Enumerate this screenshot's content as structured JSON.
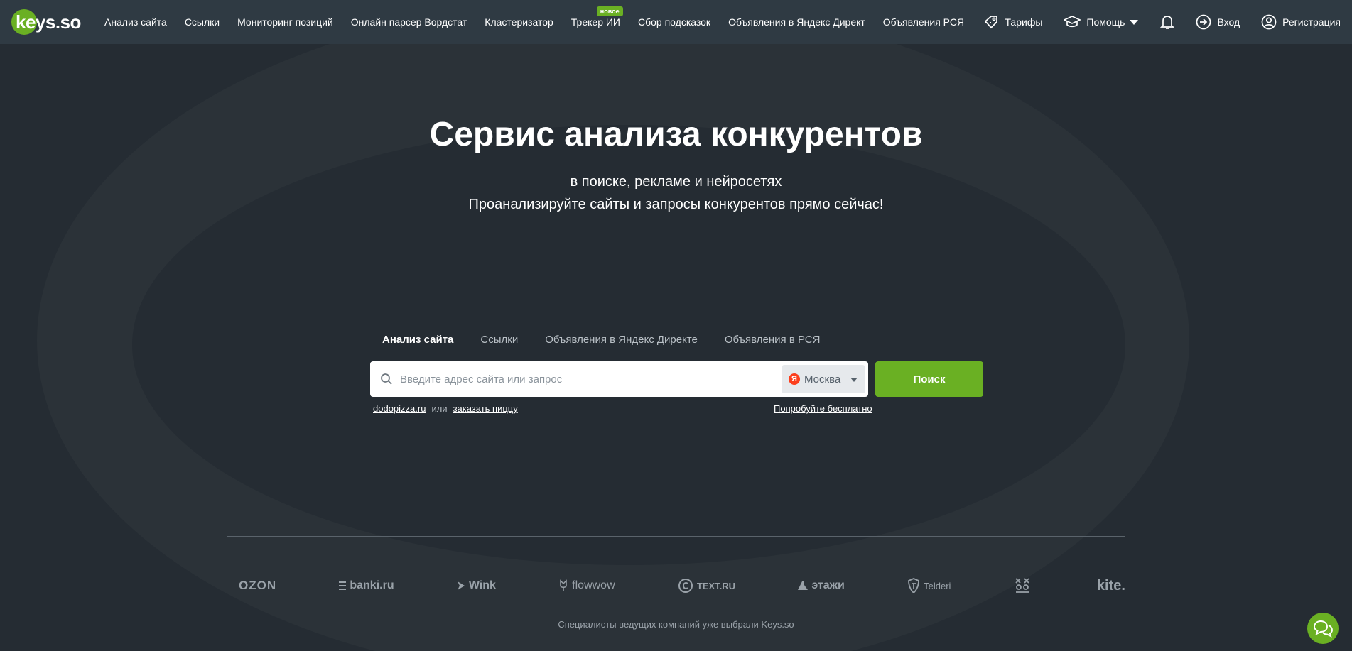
{
  "brand": {
    "name": "keys.so",
    "accent": "#6ab023"
  },
  "nav": {
    "items": [
      "Анализ сайта",
      "Ссылки",
      "Мониторинг позиций",
      "Онлайн парсер Вордстат",
      "Кластеризатор",
      "Трекер ИИ",
      "Сбор подсказок",
      "Объявления в Яндекс Директ",
      "Объявления РСЯ"
    ],
    "badge": "новое",
    "more": "···"
  },
  "right_nav": {
    "pricing": "Тарифы",
    "help": "Помощь",
    "login": "Вход",
    "register": "Регистрация"
  },
  "hero": {
    "title": "Сервис анализа конкурентов",
    "subtitle_1": "в поиске, рекламе и нейросетях",
    "subtitle_2": "Проанализируйте сайты и запросы конкурентов прямо сейчас!"
  },
  "search": {
    "tabs": [
      "Анализ сайта",
      "Ссылки",
      "Объявления в Яндекс Директе",
      "Объявления в РСЯ"
    ],
    "placeholder": "Введите адрес сайта или запрос",
    "region": "Москва",
    "region_badge": "Я",
    "button": "Поиск",
    "example_1": "dodopizza.ru",
    "example_or": "или",
    "example_2": "заказать пиццу",
    "free": "Попробуйте бесплатно"
  },
  "clients": {
    "logos": [
      "OZON",
      "banki.ru",
      "Wink",
      "flowwow",
      "TEXT.RU",
      "этажи",
      "Telderi",
      "kite."
    ],
    "tagline": "Специалисты ведущих компаний уже выбрали Keys.so"
  },
  "icons": [
    "tag-icon",
    "graduation-cap-icon",
    "bell-icon",
    "login-icon",
    "user-icon",
    "search-icon",
    "chat-icon"
  ]
}
